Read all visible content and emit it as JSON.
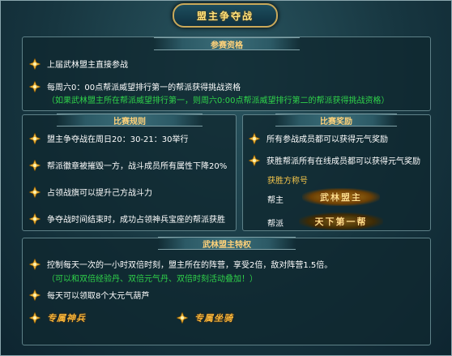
{
  "title": "盟主争夺战",
  "qualification": {
    "header": "参赛资格",
    "items": [
      "上届武林盟主直接参战",
      "每周六0：00点帮派威望排行第一的帮派获得挑战资格"
    ],
    "note": "（如果武林盟主所在帮派威望排行第一，则周六0:00点帮派威望排行第二的帮派获得挑战资格）"
  },
  "rules": {
    "header": "比赛规则",
    "items": [
      "盟主争夺战在周日20：30-21：30举行",
      "帮派徽章被摧毁一方，战斗成员所有属性下降20%",
      "占领战旗可以提升己方战斗力",
      "争夺战时间结束时，成功占领神兵宝座的帮派获胜"
    ]
  },
  "rewards": {
    "header": "比赛奖励",
    "items": [
      "所有参战成员都可以获得元气奖励",
      "获胜帮派所有在线成员都可以获得元气奖励"
    ],
    "title_label": "获胜方称号",
    "leader_label": "帮主",
    "member_label": "帮派",
    "leader_badge": "武林盟主",
    "member_badge": "天下第一帮"
  },
  "privileges": {
    "header": "武林盟主特权",
    "items": [
      "控制每天一次的一小时双倍时刻，盟主所在的阵营，享受2倍，敌对阵营1.5倍。",
      "每天可以领取8个大元气葫芦"
    ],
    "note": "（可以和双倍经验丹、双倍元气丹、双倍时刻活动叠加！）",
    "special_weapon": "专属神兵",
    "special_mount": "专属坐骑"
  },
  "colors": {
    "accent_gold": "#f5c64b",
    "note_green": "#2fd34a",
    "header_text": "#ffd27a"
  }
}
